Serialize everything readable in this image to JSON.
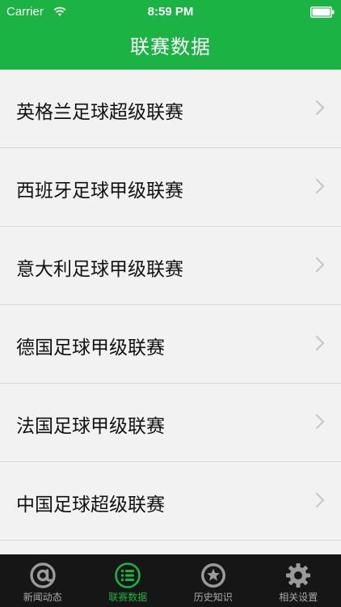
{
  "status_bar": {
    "carrier": "Carrier",
    "time": "8:59 PM",
    "wifi_icon": "wifi-icon",
    "battery_icon": "battery-icon"
  },
  "header": {
    "title": "联赛数据",
    "color": "#1bb343"
  },
  "leagues": [
    {
      "label": "英格兰足球超级联赛"
    },
    {
      "label": "西班牙足球甲级联赛"
    },
    {
      "label": "意大利足球甲级联赛"
    },
    {
      "label": "德国足球甲级联赛"
    },
    {
      "label": "法国足球甲级联赛"
    },
    {
      "label": "中国足球超级联赛"
    }
  ],
  "tabs": [
    {
      "label": "新闻动态",
      "icon": "at-icon",
      "active": false
    },
    {
      "label": "联赛数据",
      "icon": "list-icon",
      "active": true
    },
    {
      "label": "历史知识",
      "icon": "star-icon",
      "active": false
    },
    {
      "label": "相关设置",
      "icon": "gear-icon",
      "active": false
    }
  ],
  "colors": {
    "accent": "#1bb343",
    "tab_inactive": "#aaaaaa",
    "tabbar_bg": "#161616"
  }
}
